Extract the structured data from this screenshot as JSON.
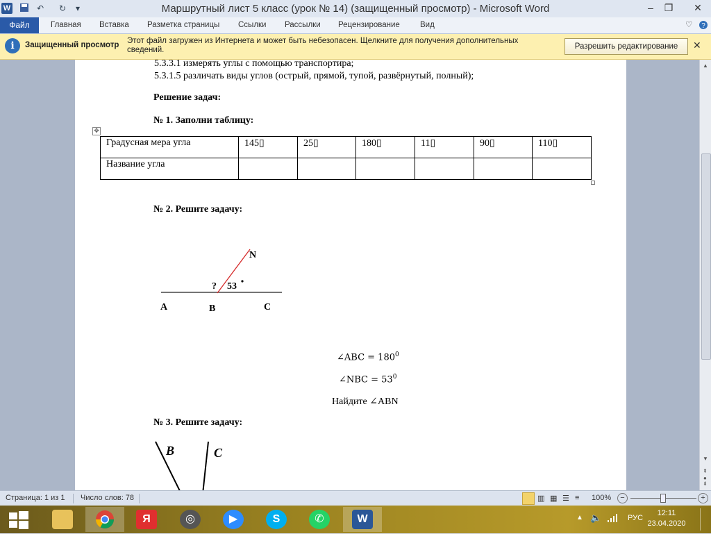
{
  "window": {
    "title": "Маршрутный лист 5 класс (урок № 14) (защищенный просмотр)  -  Microsoft Word",
    "minimize": "–",
    "maximize": "❐",
    "close": "✕"
  },
  "ribbon": {
    "file": "Файл",
    "tabs": [
      "Главная",
      "Вставка",
      "Разметка страницы",
      "Ссылки",
      "Рассылки",
      "Рецензирование",
      "Вид"
    ]
  },
  "protected_view": {
    "title": "Защищенный просмотр",
    "message": "Этот файл загружен из Интернета и может быть небезопасен. Щелкните для получения дополнительных сведений.",
    "button": "Разрешить редактирование",
    "close": "✕"
  },
  "document": {
    "line1": "5.3.3.1 измерять углы с помощью транспортира;",
    "line2": "5.3.1.5 различать виды углов (острый, прямой, тупой, развёрнутый, полный);",
    "solve_heading": "Решение задач:",
    "task1": "№ 1. Заполни таблицу:",
    "table": {
      "row1_label": "Градусная мера угла",
      "values": [
        "145",
        "25",
        "180",
        "11",
        "90",
        "110"
      ],
      "row2_label": "Название угла"
    },
    "task2": "№ 2. Решите задачу:",
    "figure2": {
      "label_N": "N",
      "label_A": "A",
      "label_B": "B",
      "label_C": "C",
      "question": "?",
      "angle": "53"
    },
    "eq1": "∠ABC = 180",
    "eq1_sup": "0",
    "eq2": "∠NBC = 53",
    "eq2_sup": "0",
    "find": "Найдите ∠ABN",
    "task3": "№ 3. Решите задачу:",
    "figure3": {
      "label_B": "B",
      "label_C": "C"
    }
  },
  "status": {
    "page": "Страница: 1 из 1",
    "words": "Число слов: 78",
    "zoom": "100%"
  },
  "taskbar": {
    "clock_time": "12:11",
    "clock_date": "23.04.2020",
    "lang": "РУС"
  },
  "colors": {
    "file_tab": "#2a5aa8",
    "protected_bar": "#fdf0b0",
    "angle_line": "#d62a2a"
  }
}
